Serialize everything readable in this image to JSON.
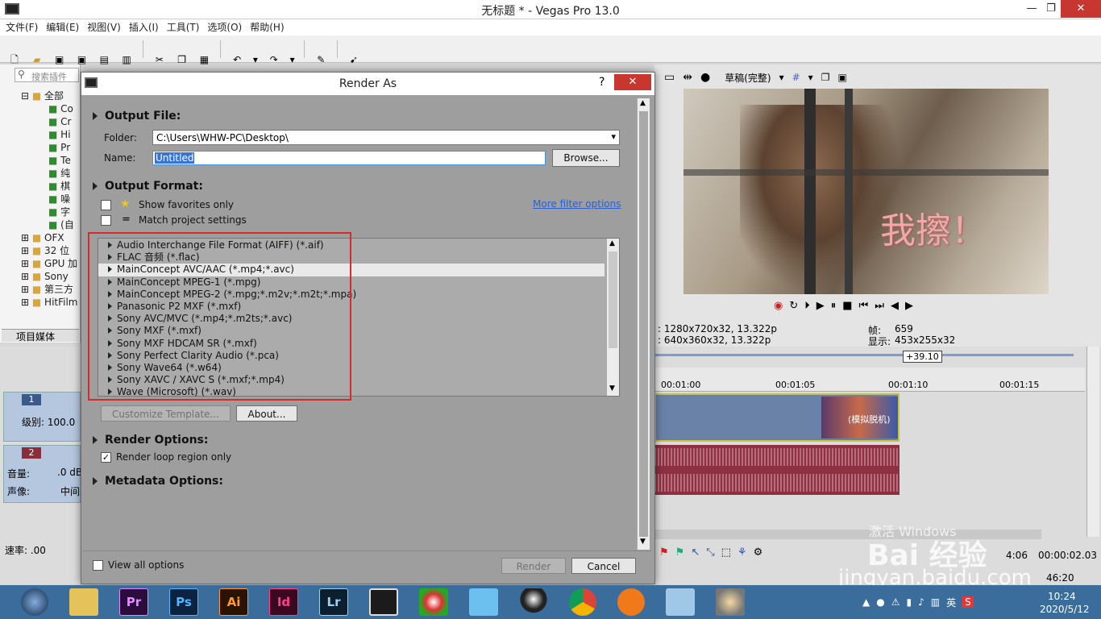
{
  "window": {
    "title": "无标题 * - Vegas Pro 13.0",
    "min": "—",
    "max": "❐",
    "close": "✕"
  },
  "menu": [
    "文件(F)",
    "编辑(E)",
    "视图(V)",
    "插入(I)",
    "工具(T)",
    "选项(O)",
    "帮助(H)"
  ],
  "left_panel": {
    "search_placeholder": "搜索插件",
    "tree": [
      "全部",
      "Co",
      "Cr",
      "Hi",
      "Pr",
      "Te",
      "纯",
      "棋",
      "噪",
      "字",
      "(自",
      "OFX",
      "32 位",
      "GPU 加",
      "Sony",
      "第三方",
      "HitFilm"
    ],
    "tab": "项目媒体"
  },
  "track_headers": {
    "track1_num": "1",
    "level": "级别: 100.0",
    "track2_num": "2",
    "volume_label": "音量:",
    "volume_value": ".0 dB",
    "pan_label": "声像:",
    "pan_value": "中间",
    "rate": "速率: .00"
  },
  "preview": {
    "quality": "草稿(完整)",
    "overlay_text": "我擦！",
    "project_info": ": 1280x720x32, 13.322p",
    "preview_info": ": 640x360x32, 13.322p",
    "frame_label": "帧:",
    "frame_value": "659",
    "display_label": "显示:",
    "display_value": "453x255x32"
  },
  "timeline": {
    "marker": "+39.10",
    "ruler": [
      "00:01:00",
      "00:01:05",
      "00:01:10",
      "00:01:15"
    ],
    "clip_label": "(模拟脱机)",
    "time1": "00:00:02.03",
    "time2": "46:20",
    "time_partial": "4:06"
  },
  "dialog": {
    "title": "Render As",
    "help": "?",
    "close": "✕",
    "output_file_header": "Output File:",
    "folder_label": "Folder:",
    "folder_value": "C:\\Users\\WHW-PC\\Desktop\\",
    "name_label": "Name:",
    "name_value": "Untitled",
    "browse": "Browse...",
    "output_format_header": "Output Format:",
    "show_favorites": "Show favorites only",
    "match_project": "Match project settings",
    "more_filter": "More filter options",
    "formats": [
      "Audio Interchange File Format (AIFF) (*.aif)",
      "FLAC 音频 (*.flac)",
      "MainConcept AVC/AAC (*.mp4;*.avc)",
      "MainConcept MPEG-1 (*.mpg)",
      "MainConcept MPEG-2 (*.mpg;*.m2v;*.m2t;*.mpa)",
      "Panasonic P2 MXF (*.mxf)",
      "Sony AVC/MVC (*.mp4;*.m2ts;*.avc)",
      "Sony MXF (*.mxf)",
      "Sony MXF HDCAM SR (*.mxf)",
      "Sony Perfect Clarity Audio (*.pca)",
      "Sony Wave64 (*.w64)",
      "Sony XAVC / XAVC S (*.mxf;*.mp4)",
      "Wave (Microsoft) (*.wav)"
    ],
    "selected_format_index": 2,
    "customize": "Customize Template...",
    "about": "About...",
    "render_options_header": "Render Options:",
    "render_loop": "Render loop region only",
    "metadata_header": "Metadata Options:",
    "view_all": "View all options",
    "render": "Render",
    "cancel": "Cancel"
  },
  "taskbar": {
    "apps": [
      "Pr",
      "Ps",
      "Ai",
      "Id",
      "Lr"
    ],
    "time": "10:24",
    "date": "2020/5/12",
    "ime": "英"
  },
  "watermark": {
    "line1": "激活 Windows",
    "line2": "Bai 经验",
    "line3": "jingyan.baidu.com"
  },
  "colors": {
    "dialog_bg": "#9e9e9e",
    "highlight_box": "#d52b2b",
    "link": "#2a5fd0",
    "taskbar": "#3b6d9c",
    "audio_wave": "#8e2f42"
  }
}
